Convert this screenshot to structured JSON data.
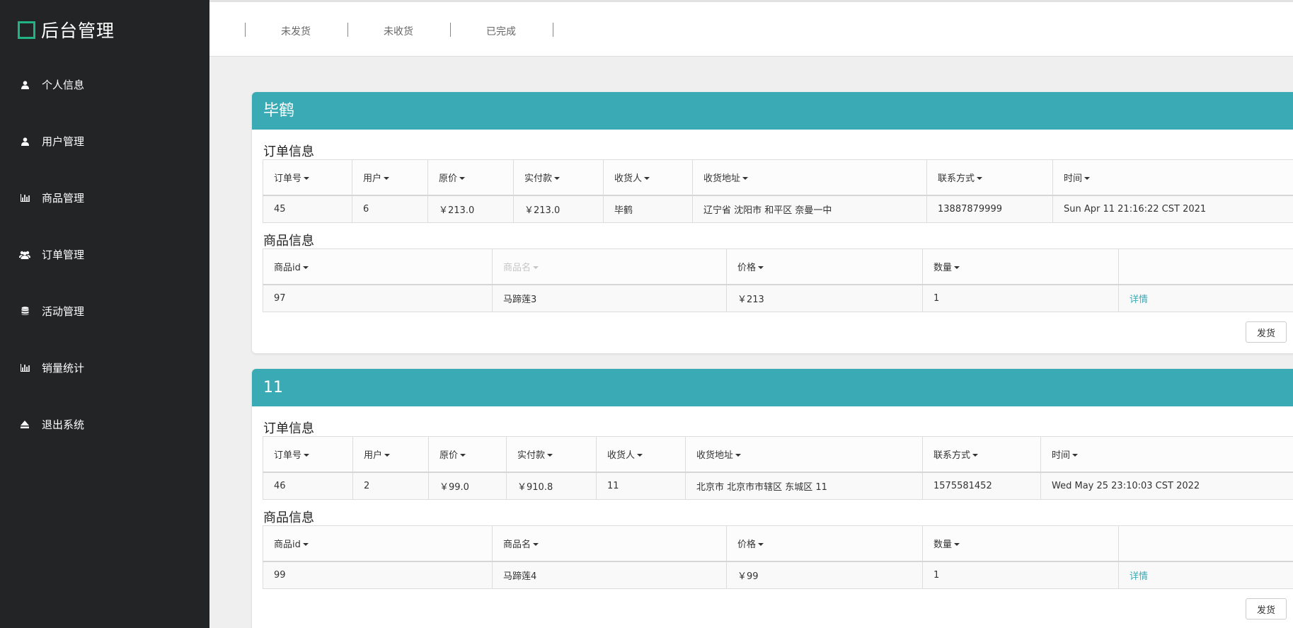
{
  "brand": {
    "title": "后台管理",
    "accent": "#21b384"
  },
  "sidebar": {
    "items": [
      {
        "label": "个人信息",
        "icon": "user-icon"
      },
      {
        "label": "用户管理",
        "icon": "user-icon"
      },
      {
        "label": "商品管理",
        "icon": "bar-chart-icon"
      },
      {
        "label": "订单管理",
        "icon": "users-icon"
      },
      {
        "label": "活动管理",
        "icon": "database-icon"
      },
      {
        "label": "销量统计",
        "icon": "bar-chart-icon"
      },
      {
        "label": "退出系统",
        "icon": "eject-icon"
      }
    ]
  },
  "topnav": {
    "tabs": [
      "未发货",
      "未收货",
      "已完成"
    ]
  },
  "colors": {
    "header": "#3aabb5",
    "sidebar": "#222426",
    "content_bg": "#efefef"
  },
  "labels": {
    "order_info": "订单信息",
    "product_info": "商品信息",
    "details": "详情",
    "ship": "发货"
  },
  "order_columns": [
    "订单号",
    "用户",
    "原价",
    "实付款",
    "收货人",
    "收货地址",
    "联系方式",
    "时间"
  ],
  "product_columns": [
    "商品id",
    "商品名",
    "价格",
    "数量"
  ],
  "orders": [
    {
      "title": "毕鹤",
      "order": {
        "id": "45",
        "user": "6",
        "original_price": "￥213.0",
        "paid": "￥213.0",
        "receiver": "毕鹤",
        "address": "辽宁省 沈阳市 和平区 奈曼一中",
        "phone": "13887879999",
        "time": "Sun Apr 11 21:16:22 CST 2021"
      },
      "product": {
        "id": "97",
        "name": "马蹄莲3",
        "price": "￥213",
        "quantity": "1"
      }
    },
    {
      "title": "11",
      "order": {
        "id": "46",
        "user": "2",
        "original_price": "￥99.0",
        "paid": "￥910.8",
        "receiver": "11",
        "address": "北京市 北京市市辖区 东城区 11",
        "phone": "1575581452",
        "time": "Wed May 25 23:10:03 CST 2022"
      },
      "product": {
        "id": "99",
        "name": "马蹄莲4",
        "price": "￥99",
        "quantity": "1"
      }
    }
  ]
}
